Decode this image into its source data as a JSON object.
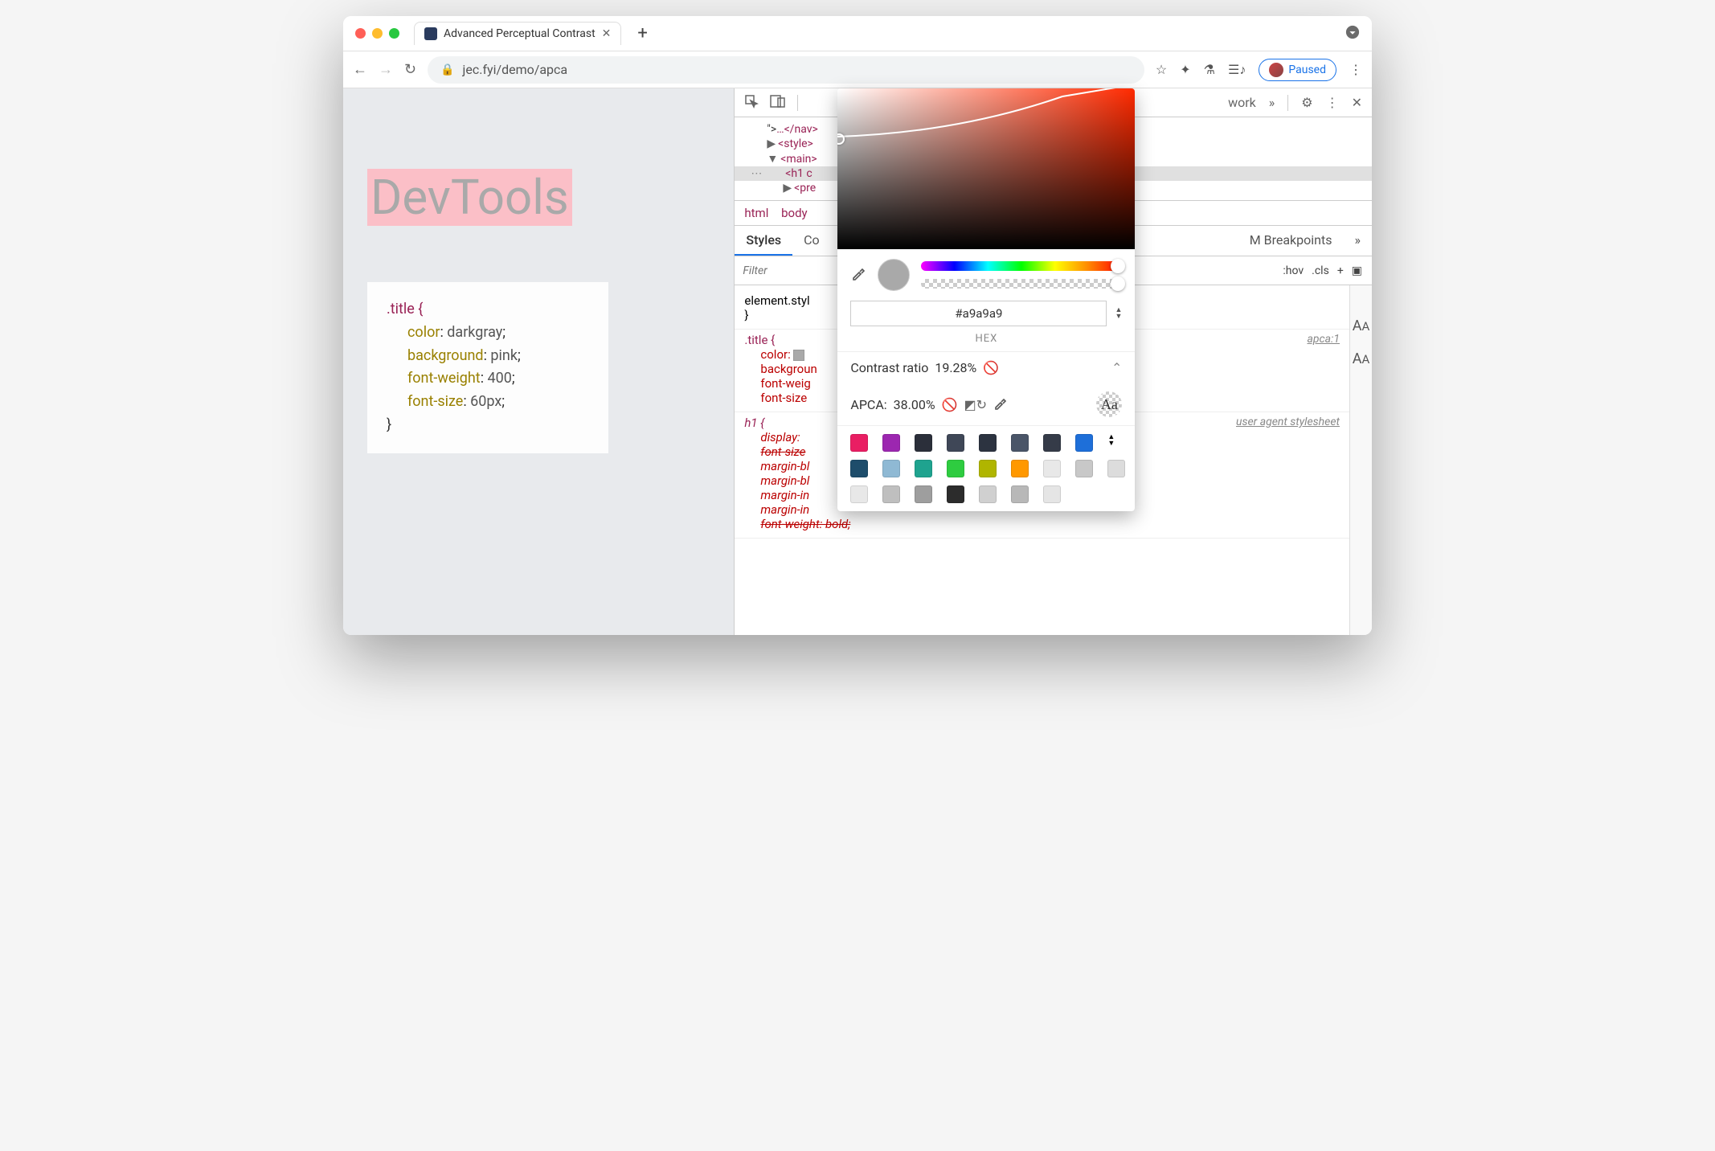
{
  "tab": {
    "title": "Advanced Perceptual Contrast"
  },
  "url": "jec.fyi/demo/apca",
  "paused_label": "Paused",
  "devtools": {
    "visible_tab_end": "work",
    "dom": {
      "nav_close": "…</nav>",
      "style": "<style>",
      "main": "<main>",
      "h1": "<h1 c",
      "pre": "<pre "
    },
    "breadcrumbs": [
      "html",
      "body"
    ],
    "panel_tabs": {
      "active": "Styles",
      "second_partial": "Co",
      "right_partial": "M Breakpoints"
    },
    "filter_placeholder": "Filter",
    "toolbar": {
      "hov": ":hov",
      "cls": ".cls"
    }
  },
  "styles": {
    "element_style": "element.styl",
    "title_rule": {
      "selector": ".title {",
      "props": [
        "color: ",
        "backgroun",
        "font-weig",
        "font-size"
      ],
      "source": "apca:1"
    },
    "h1_rule": {
      "selector": "h1 {",
      "props": [
        "display: ",
        "font-size",
        "margin-bl",
        "margin-bl",
        "margin-in",
        "margin-in",
        "font-weight: bold;"
      ],
      "source": "user agent stylesheet"
    }
  },
  "page": {
    "heading": "DevTools",
    "css": {
      "selector": ".title {",
      "lines": [
        {
          "prop": "color",
          "val": "darkgray"
        },
        {
          "prop": "background",
          "val": "pink"
        },
        {
          "prop": "font-weight",
          "val": "400"
        },
        {
          "prop": "font-size",
          "val": "60px"
        }
      ],
      "close": "}"
    }
  },
  "colorpicker": {
    "hex": "#a9a9a9",
    "hex_label": "HEX",
    "contrast_label": "Contrast ratio",
    "contrast_value": "19.28%",
    "apca_label": "APCA:",
    "apca_value": "38.00%",
    "palette": [
      "#e91e63",
      "#9c27b0",
      "#2b2f3a",
      "#3f4757",
      "#2c3340",
      "#4a5568",
      "#353b48",
      "#1e6fd9",
      "#1e4d6b",
      "#8fb9d4",
      "#1fa38f",
      "#2ecc40",
      "#b0b500",
      "#ff9800",
      "#e8e8e8",
      "#c8c8c8",
      "#dcdcdc",
      "#e8e8e8",
      "#bfbfbf",
      "#9e9e9e",
      "#2c2c2c",
      "#d0d0d0",
      "#b8b8b8",
      "#e5e5e5"
    ]
  }
}
